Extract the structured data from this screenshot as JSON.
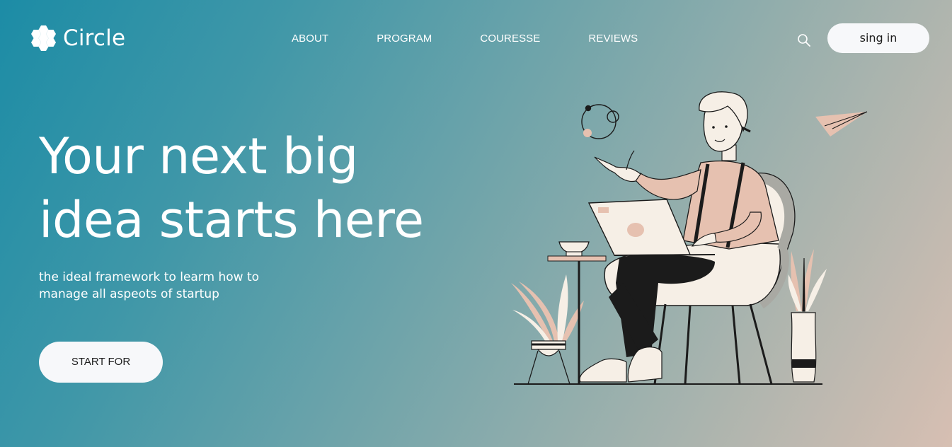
{
  "brand": {
    "name": "Circle",
    "icon": "hexagon-cluster-logo-icon"
  },
  "nav": {
    "items": [
      {
        "label": "ABOUT"
      },
      {
        "label": "PROGRAM"
      },
      {
        "label": "COURESSE"
      },
      {
        "label": "REVIEWS"
      }
    ]
  },
  "header": {
    "search_icon": "search-icon",
    "signin_label": "sing in"
  },
  "hero": {
    "title_line1": "Your next big",
    "title_line2": "idea starts here",
    "subtitle_line1": "the ideal framework to learm how to",
    "subtitle_line2": "manage all aspeots of startup",
    "cta_label": "START FOR"
  },
  "colors": {
    "gradient_start": "#1c8ca6",
    "gradient_end": "#d7bfb2",
    "button_bg": "#f7f8fa",
    "accent_peach": "#e6c1b0"
  }
}
